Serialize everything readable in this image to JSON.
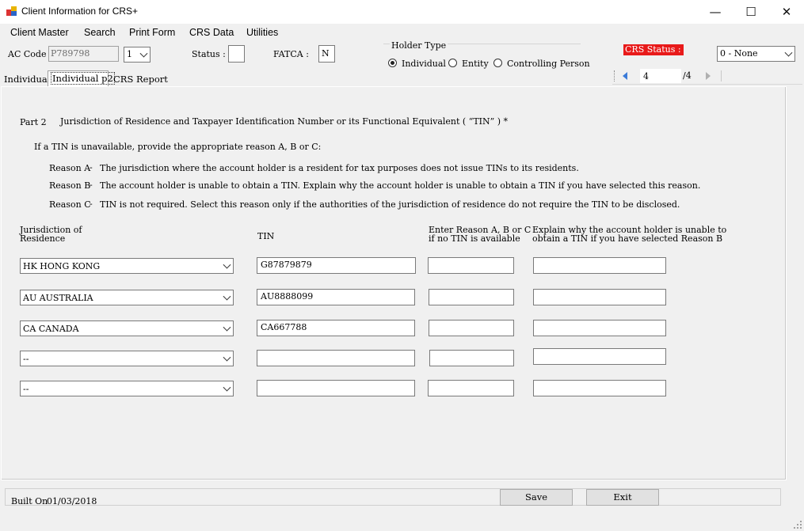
{
  "window": {
    "title": "Client Information for CRS+"
  },
  "menu": [
    "Client Master",
    "Search",
    "Print Form",
    "CRS Data",
    "Utilities"
  ],
  "header": {
    "ac_code_label": "AC Code :",
    "ac_code_value": "P789798",
    "ac_seq_value": "1",
    "status_label": "Status :",
    "status_value": "",
    "fatca_label": "FATCA :",
    "fatca_value": "N",
    "holder_type_label": "Holder Type",
    "holder_types": [
      "Individual",
      "Entity",
      "Controlling Person"
    ],
    "holder_type_selected": "Individual",
    "crs_status_label": "CRS Status :",
    "crs_status_value": "0 - None",
    "crs_status_color": "#e81a1a",
    "nav_current": "4",
    "nav_total": "/4"
  },
  "tabs": [
    "Individual",
    "Individual p2",
    "CRS Report"
  ],
  "active_tab": "Individual p2",
  "part": {
    "number": "Part 2",
    "title": "Jurisdiction of Residence and Taxpayer Identification Number or its Functional Equivalent ( “TIN” ) *",
    "intro": "If a TIN is unavailable, provide the appropriate reason A, B or C:",
    "reasons": [
      {
        "label": "Reason A",
        "text": "The jurisdiction where the account holder is a resident for tax purposes does not issue TINs to its residents."
      },
      {
        "label": "Reason B",
        "text": "The account holder is unable to obtain a TIN. Explain why the account holder is unable to obtain a TIN if you have selected this reason."
      },
      {
        "label": "Reason C",
        "text": "TIN is not required. Select this reason only if the authorities of the jurisdiction of residence do not require the TIN to be disclosed."
      }
    ]
  },
  "table": {
    "headers": {
      "jurisdiction": [
        "Jurisdiction of",
        "Residence"
      ],
      "tin": "TIN",
      "reason": [
        "Enter Reason A, B or C",
        "if no TIN is available"
      ],
      "explain": [
        "Explain why the account holder is unable to",
        "obtain a TIN if you have selected Reason B"
      ]
    },
    "rows": [
      {
        "jurisdiction": "HK  HONG KONG",
        "tin": "G87879879",
        "reason": "",
        "explain": ""
      },
      {
        "jurisdiction": "AU  AUSTRALIA",
        "tin": "AU8888099",
        "reason": "",
        "explain": ""
      },
      {
        "jurisdiction": "CA  CANADA",
        "tin": "CA667788",
        "reason": "",
        "explain": ""
      },
      {
        "jurisdiction": "--",
        "tin": "",
        "reason": "",
        "explain": ""
      },
      {
        "jurisdiction": "--",
        "tin": "",
        "reason": "",
        "explain": ""
      }
    ]
  },
  "footer": {
    "built_on_label": "Built On",
    "built_on_date": "01/03/2018",
    "save_label": "Save",
    "exit_label": "Exit"
  }
}
